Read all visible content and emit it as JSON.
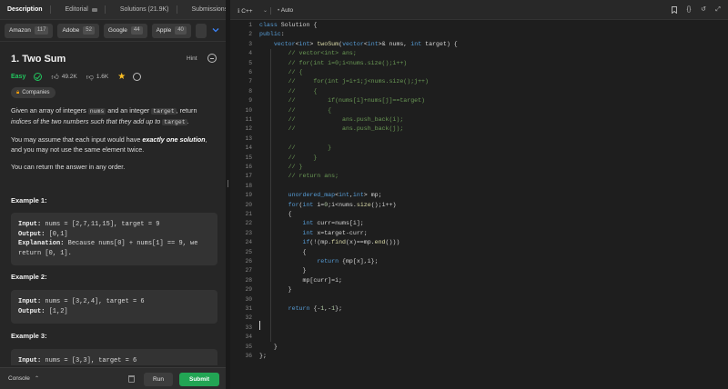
{
  "tabs": [
    {
      "label": "Description",
      "active": true
    },
    {
      "label": "Editorial",
      "active": false
    },
    {
      "label": "Solutions (21.9K)",
      "active": false
    },
    {
      "label": "Submissions",
      "active": false
    }
  ],
  "companies": [
    {
      "name": "Amazon",
      "count": "117"
    },
    {
      "name": "Adobe",
      "count": "52"
    },
    {
      "name": "Google",
      "count": "44"
    },
    {
      "name": "Apple",
      "count": "40"
    }
  ],
  "problem": {
    "title": "1. Two Sum",
    "hint_label": "Hint",
    "difficulty": "Easy",
    "likes": "49.2K",
    "dislikes": "1.6K",
    "companies_label": "Companies",
    "desc1_pre": "Given an array of integers ",
    "desc1_code1": "nums",
    "desc1_mid": " and an integer ",
    "desc1_code2": "target",
    "desc1_post": ", return ",
    "desc1_italic": "indices of the two numbers such that they add up to ",
    "desc1_code3": "target",
    "desc1_end": ".",
    "desc2_pre": "You may assume that each input would have ",
    "desc2_bold": "exactly one solution",
    "desc2_post": ", and you may not use the same element twice.",
    "desc3": "You can return the answer in any order."
  },
  "examples": [
    {
      "title": "Example 1:",
      "input_label": "Input:",
      "input": " nums = [2,7,11,15], target = 9",
      "output_label": "Output:",
      "output": " [0,1]",
      "explanation_label": "Explanation:",
      "explanation": " Because nums[0] + nums[1] == 9, we",
      "explanation2": "return [0, 1]."
    },
    {
      "title": "Example 2:",
      "input_label": "Input:",
      "input": " nums = [3,2,4], target = 6",
      "output_label": "Output:",
      "output": " [1,2]"
    },
    {
      "title": "Example 3:",
      "input_label": "Input:",
      "input": " nums = [3,3], target = 6"
    }
  ],
  "bottom": {
    "console_label": "Console",
    "run_label": "Run",
    "submit_label": "Submit"
  },
  "editor": {
    "language": "C++",
    "mode": "Auto",
    "code_lines": [
      "class Solution {",
      "public:",
      "    vector<int> twoSum(vector<int>& nums, int target) {",
      "        // vector<int> ans;",
      "        // for(int i=0;i<nums.size();i++)",
      "        // {",
      "        //     for(int j=i+1;j<nums.size();j++)",
      "        //     {",
      "        //         if(nums[i]+nums[j]==target)",
      "        //         {",
      "        //             ans.push_back(i);",
      "        //             ans.push_back(j);",
      "",
      "        //         }",
      "        //     }",
      "        // }",
      "        // return ans;",
      "",
      "        unordered_map<int,int> mp;",
      "        for(int i=0;i<nums.size();i++)",
      "        {",
      "            int curr=nums[i];",
      "            int x=target-curr;",
      "            if(!(mp.find(x)==mp.end()))",
      "            {",
      "                return {mp[x],i};",
      "            }",
      "            mp[curr]=i;",
      "        }",
      "",
      "        return {-1,-1};",
      "",
      "",
      "",
      "    }",
      "};"
    ],
    "line_numbers": [
      "1",
      "2",
      "3",
      "4",
      "5",
      "6",
      "7",
      "8",
      "9",
      "10",
      "11",
      "12",
      "13",
      "14",
      "15",
      "16",
      "17",
      "18",
      "19",
      "20",
      "21",
      "22",
      "23",
      "24",
      "25",
      "26",
      "27",
      "28",
      "29",
      "30",
      "31",
      "32",
      "33",
      "34",
      "35",
      "36"
    ]
  }
}
